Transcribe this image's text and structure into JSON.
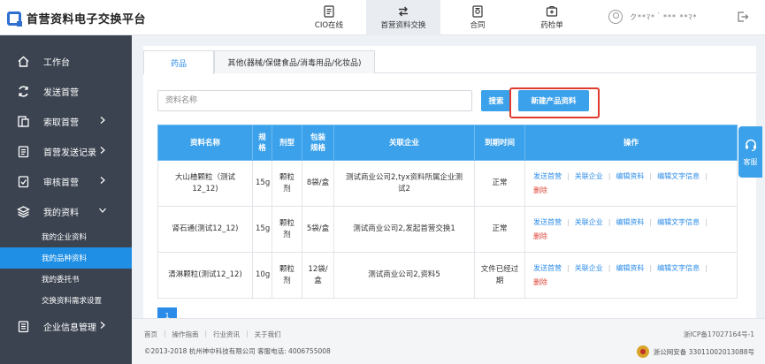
{
  "brand": {
    "title": "首营资料电子交换平台"
  },
  "topnav": [
    {
      "label": "CIO在线",
      "icon": "document-icon",
      "active": false
    },
    {
      "label": "首营资料交换",
      "icon": "swap-icon",
      "active": true
    },
    {
      "label": "合同",
      "icon": "contract-icon",
      "active": false
    },
    {
      "label": "药检单",
      "icon": "inspection-icon",
      "active": false
    }
  ],
  "user": {
    "name": "ク**ﾏ*｀*** **ﾏ*"
  },
  "sidebar": {
    "items": [
      {
        "label": "工作台",
        "icon": "home-icon",
        "has_chevron": false
      },
      {
        "label": "发送首营",
        "icon": "send-icon",
        "has_chevron": false
      },
      {
        "label": "索取首营",
        "icon": "request-icon",
        "has_chevron": true
      },
      {
        "label": "首营发送记录",
        "icon": "record-icon",
        "has_chevron": true
      },
      {
        "label": "审核首营",
        "icon": "audit-icon",
        "has_chevron": true
      },
      {
        "label": "我的资料",
        "icon": "layers-icon",
        "has_chevron": true,
        "expanded": true
      }
    ],
    "subitems": [
      {
        "label": "我的企业资料",
        "active": false
      },
      {
        "label": "我的品种资料",
        "active": true
      },
      {
        "label": "我的委托书",
        "active": false
      },
      {
        "label": "交换资料需求设置",
        "active": false
      }
    ],
    "bottom_item": {
      "label": "企业信息管理",
      "icon": "enterprise-icon",
      "has_chevron": true
    }
  },
  "tabs": [
    {
      "label": "药品",
      "active": true
    },
    {
      "label": "其他(器械/保健食品/消毒用品/化妆品)",
      "active": false
    }
  ],
  "search": {
    "placeholder": "资料名称",
    "value": "",
    "button_label": "搜索",
    "new_button_label": "新建产品资料"
  },
  "table": {
    "headers": [
      "资料名称",
      "规格",
      "剂型",
      "包装规格",
      "关联企业",
      "到期时间",
      "操作"
    ],
    "rows": [
      {
        "name": "大山楂颗粒（测试12_12)",
        "spec": "15g",
        "form": "颗粒剂",
        "pack": "8袋/盒",
        "company": "测试商业公司2,tyx资料所属企业测试2",
        "expiry": "正常"
      },
      {
        "name": "肾石通(测试12_12)",
        "spec": "15g",
        "form": "颗粒剂",
        "pack": "5袋/盒",
        "company": "测试商业公司2,发起首营交换1",
        "expiry": "正常"
      },
      {
        "name": "清淋颗粒(测试12_12)",
        "spec": "10g",
        "form": "颗粒剂",
        "pack": "12袋/盒",
        "company": "测试商业公司2,资料5",
        "expiry": "文件已经过期"
      }
    ],
    "actions": [
      "发送首营",
      "关联企业",
      "编辑资料",
      "编辑文字信息",
      "删除"
    ]
  },
  "pager": {
    "current": "1"
  },
  "footer": {
    "links": [
      "首页",
      "操作指南",
      "行业资讯",
      "关于我们"
    ],
    "copyright": "©2013-2018  杭州神中科技有限公司  客服电话: 4006755008",
    "icp": "浙ICP备17027164号-1",
    "police": "浙公网安备 33011002013088号"
  },
  "kefu": {
    "label": "客服"
  },
  "colors": {
    "accent": "#3ba1ea",
    "sidebar_bg": "#3b4350",
    "highlight": "#e03a2e",
    "danger": "#e0463a"
  }
}
